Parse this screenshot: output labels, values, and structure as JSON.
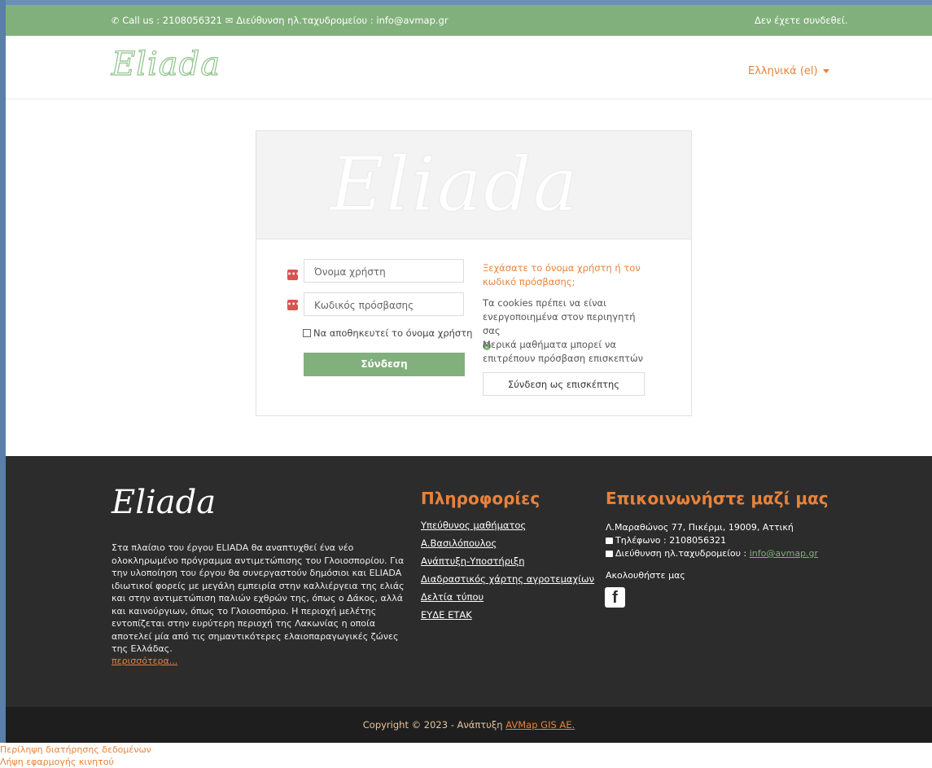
{
  "topbar": {
    "call_text": "Call us : 2108056321",
    "email_text": "Διεύθυνση ηλ.ταχυδρομείου : info@avmap.gr",
    "login_status": "Δεν έχετε συνδεθεί."
  },
  "header": {
    "logo_text": "Eliada",
    "language": "Ελληνικά (el)"
  },
  "login": {
    "hero_text": "Eliada",
    "username_placeholder": "Όνομα χρήστη",
    "password_placeholder": "Κωδικός πρόσβασης",
    "remember_label": "Να αποθηκευτεί το όνομα χρήστη",
    "login_button": "Σύνδεση",
    "forgot_link": "Ξεχάσατε το όνομα χρήστη ή τον κωδικό πρόσβασης;",
    "cookies_notice": "Τα cookies πρέπει να είναι ενεργοποιημένα στον περιηγητή σας",
    "guest_notice": "Μερικά μαθήματα μπορεί να επιτρέπουν πρόσβαση επισκεπτών",
    "guest_button": "Σύνδεση ως επισκέπτης"
  },
  "footer": {
    "logo_text": "Eliada",
    "about_text": "Στα πλαίσιο του έργου ELIADA θα αναπτυχθεί ένα νέο ολοκληρωμένο πρόγραμμα αντιμετώπισης του Γλοιοσπορίου. Για την υλοποίηση του έργου θα συνεργαστούν δημόσιοι και ELIADA ιδιωτικοί φορείς με μεγάλη εμπειρία στην καλλιέργεια της ελιάς και στην αντιμετώπιση παλιών εχθρών της, όπως ο Δάκος, αλλά και καινούργιων, όπως το Γλοιοσπόριο. Η περιοχή μελέτης εντοπίζεται στην ευρύτερη περιοχή της Λακωνίας η οποία αποτελεί μία από τις σημαντικότερες ελαιοπαραγωγικές ζώνες της Ελλάδας.",
    "more_link": "περισσότερα...",
    "info_heading": "Πληροφορίες",
    "info_links": [
      "Υπεύθυνος μαθήματος",
      "Α.Βασιλόπουλος",
      "Ανάπτυξη-Υποστήριξη",
      "Διαδραστικός χάρτης αγροτεμαχίων",
      "Δελτία τύπου",
      "ΕΥΔΕ ΕΤΑΚ"
    ],
    "contact_heading": "Επικοινωνήστε μαζί μας",
    "address": "Λ.Μαραθώνος 77, Πικέρμι, 19009, Αττική",
    "phone": "Τηλέφωνο : 2108056321",
    "email_label": "Διεύθυνση ηλ.ταχυδρομείου :",
    "email_value": "info@avmap.gr",
    "follow_label": "Ακολουθήστε μας",
    "facebook_icon": "facebook-icon"
  },
  "copyright": {
    "text": "Copyright © 2023 - Ανάπτυξη",
    "company_link": "AVMap GIS AE."
  },
  "bottom_links": [
    "Περίληψη διατήρησης δεδομένων",
    "Λήψη εφαρμογής κινητού"
  ],
  "colors": {
    "accent_green": "#82b07c",
    "accent_orange": "#e8823a",
    "footer_dark": "#2c2c2c"
  }
}
